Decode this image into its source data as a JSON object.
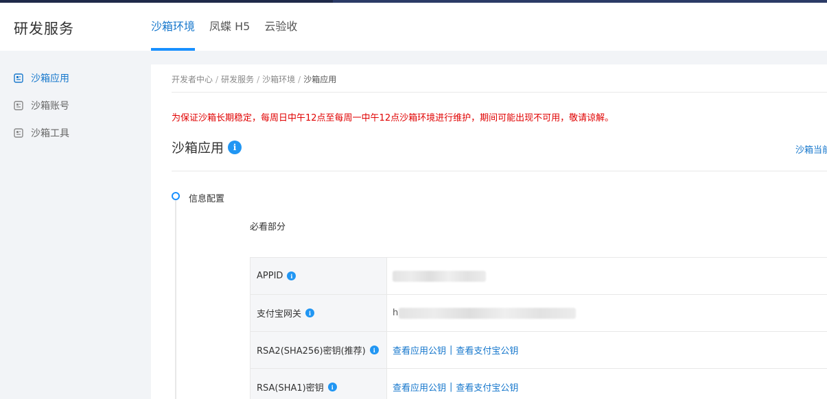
{
  "header": {
    "brand": "研发服务",
    "tabs": [
      {
        "label": "沙箱环境",
        "active": true
      },
      {
        "label": "凤蝶 H5",
        "active": false
      },
      {
        "label": "云验收",
        "active": false
      }
    ]
  },
  "sidebar": {
    "items": [
      {
        "label": "沙箱应用",
        "active": true,
        "icon": "app-icon"
      },
      {
        "label": "沙箱账号",
        "active": false,
        "icon": "app-icon"
      },
      {
        "label": "沙箱工具",
        "active": false,
        "icon": "app-icon"
      }
    ]
  },
  "breadcrumb": [
    "开发者中心",
    "研发服务",
    "沙箱环境",
    "沙箱应用"
  ],
  "notice": "为保证沙箱长期稳定，每周日中午12点至每周一中午12点沙箱环境进行维护，期间可能出现不可用，敬请谅解。",
  "page": {
    "title": "沙箱应用",
    "right_link": "沙箱当前"
  },
  "timeline": {
    "step_label": "信息配置",
    "section_label": "必看部分"
  },
  "config": {
    "rows": [
      {
        "key": "APPID"
      },
      {
        "key": "支付宝网关",
        "prefix": "h"
      },
      {
        "key": "RSA2(SHA256)密钥(推荐)",
        "link1": "查看应用公钥",
        "sep": "|",
        "link2": "查看支付宝公钥"
      },
      {
        "key": "RSA(SHA1)密钥",
        "link1": "查看应用公钥",
        "sep": "|",
        "link2": "查看支付宝公钥"
      }
    ]
  },
  "colors": {
    "accent": "#1890ff",
    "link": "#1677cc",
    "notice": "#e00000",
    "topbar": "#2b3b66"
  }
}
